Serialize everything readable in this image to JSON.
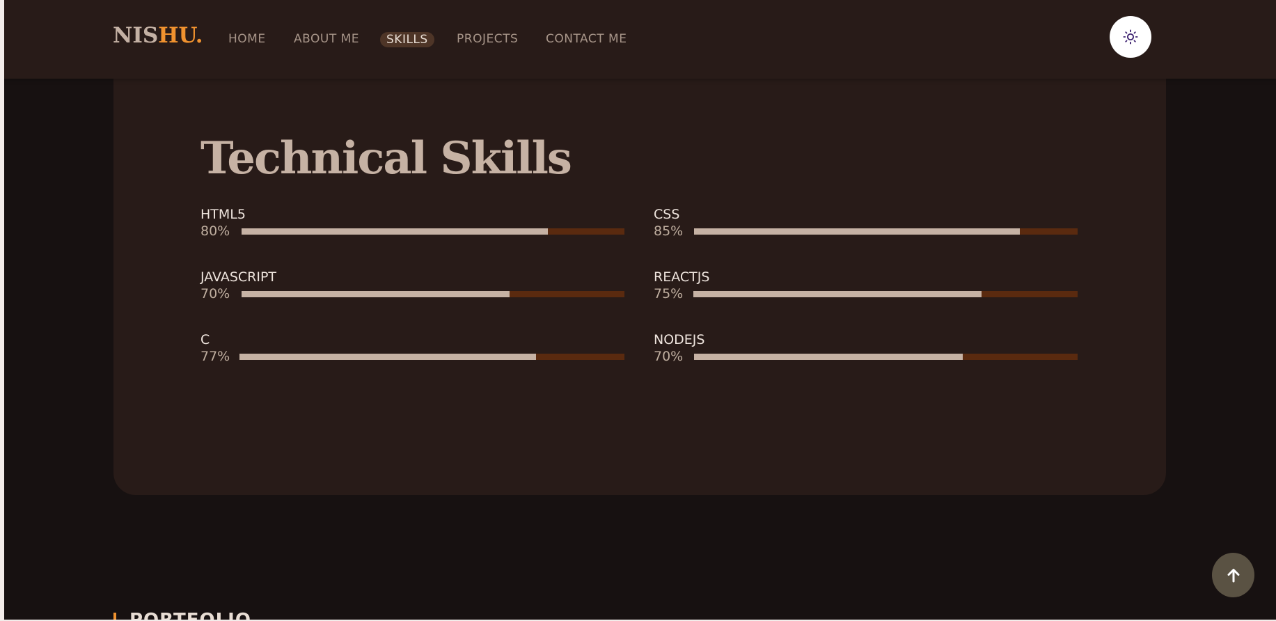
{
  "colors": {
    "page_bg": "#171111",
    "navbar_bg": "#281b18",
    "card_bg": "#281b18",
    "accent_orange": "#f0922f",
    "bar_fill": "#c6b2a4",
    "bar_track": "#5a2a0f",
    "active_pill_bg": "#4e3527",
    "scroll_button_bg": "#5a5243"
  },
  "nav": {
    "logo_main": "NIS",
    "logo_accent": "HU.",
    "links": [
      {
        "label": "HOME"
      },
      {
        "label": "ABOUT ME"
      },
      {
        "label": "SKILLS",
        "active": true
      },
      {
        "label": "PROJECTS"
      },
      {
        "label": "CONTACT ME"
      }
    ],
    "theme_toggle_icon": "sun-icon"
  },
  "skills": {
    "title": "Technical Skills",
    "items": [
      {
        "name": "HTML5",
        "percent_label": "80%",
        "fill": 0.8
      },
      {
        "name": "CSS",
        "percent_label": "85%",
        "fill": 0.85
      },
      {
        "name": "JAVASCRIPT",
        "percent_label": "70%",
        "fill": 0.7
      },
      {
        "name": "REACTJS",
        "percent_label": "75%",
        "fill": 0.75
      },
      {
        "name": "C",
        "percent_label": "77%",
        "fill": 0.77
      },
      {
        "name": "NODEJS",
        "percent_label": "70%",
        "fill": 0.7
      }
    ]
  },
  "portfolio": {
    "label": "PORTFOLIO"
  },
  "scroll_top": {
    "icon": "arrow-up-icon"
  }
}
